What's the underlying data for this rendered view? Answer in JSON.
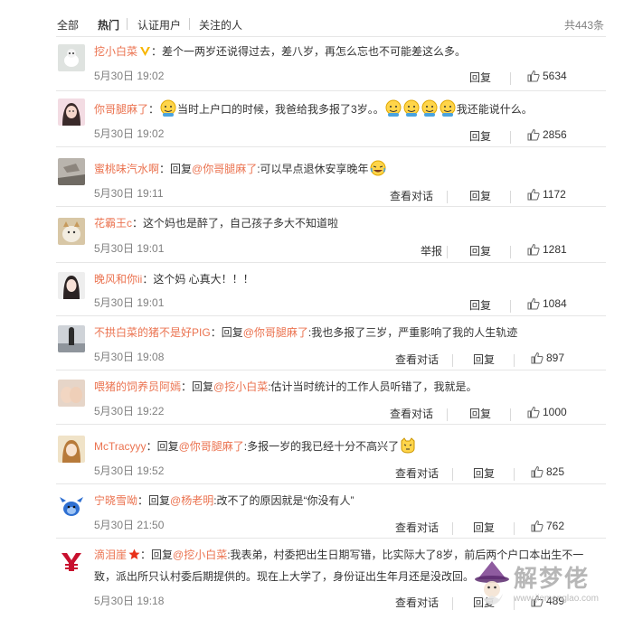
{
  "tabs": {
    "all": "全部",
    "hot": "热门",
    "verified": "认证用户",
    "following": "关注的人",
    "total": "共443条"
  },
  "comments": [
    {
      "user": "挖小白菜",
      "text": "：差个一两岁还说得过去，差八岁，再怎么忘也不可能差这么多。",
      "time": "5月30日 19:02",
      "actions": [
        "回复"
      ],
      "likes": "5634"
    },
    {
      "user": "你哥腿麻了",
      "text_a": "：",
      "text_b": "当时上户口的时候，我爸给我多报了3岁。。",
      "text_c": "我还能说什么。",
      "time": "5月30日 19:02",
      "actions": [
        "回复"
      ],
      "likes": "2856"
    },
    {
      "user": "蜜桃味汽水啊",
      "reply_prefix": "：回复",
      "mention": "@你哥腿麻了",
      "text": ":可以早点退休安享晚年",
      "time": "5月30日 19:11",
      "actions": [
        "查看对话",
        "回复"
      ],
      "likes": "1172"
    },
    {
      "user": "花霸王c",
      "text": "：这个妈也是醉了，自己孩子多大不知道啦",
      "time": "5月30日 19:01",
      "actions": [
        "举报",
        "回复"
      ],
      "likes": "1281"
    },
    {
      "user": "晚风和你ii",
      "text": "：这个妈 心真大！！！",
      "time": "5月30日 19:01",
      "actions": [
        "回复"
      ],
      "likes": "1084"
    },
    {
      "user": "不拱白菜的猪不是好PIG",
      "reply_prefix": "：回复",
      "mention": "@你哥腿麻了",
      "text": ":我也多报了三岁，严重影响了我的人生轨迹",
      "time": "5月30日 19:08",
      "actions": [
        "查看对话",
        "回复"
      ],
      "likes": "897"
    },
    {
      "user": "喂猪的饲养员阿嫣",
      "reply_prefix": "：回复",
      "mention": "@挖小白菜",
      "text": ":估计当时统计的工作人员听错了，我就是。",
      "time": "5月30日 19:22",
      "actions": [
        "查看对话",
        "回复"
      ],
      "likes": "1000"
    },
    {
      "user": "McTracyyy",
      "reply_prefix": "：回复",
      "mention": "@你哥腿麻了",
      "text": ":多报一岁的我已经十分不高兴了",
      "time": "5月30日 19:52",
      "actions": [
        "查看对话",
        "回复"
      ],
      "likes": "825"
    },
    {
      "user": "宁晓雪呦",
      "reply_prefix": "：回复",
      "mention": "@杨老明",
      "text": ":改不了的原因就是“你没有人”",
      "time": "5月30日 21:50",
      "actions": [
        "查看对话",
        "回复"
      ],
      "likes": "762"
    },
    {
      "user": "滴泪崖",
      "reply_prefix": "：回复",
      "mention": "@挖小白菜",
      "text_line1": ":我表弟，村委把出生日期写错，比实际大了8岁，前后两个户口本出生不一",
      "text_line2": "致，派出所只认村委后期提供的。现在上大学了，身份证出生年月还是没改回。",
      "time": "5月30日 19:18",
      "actions": [
        "查看对话",
        "回复"
      ],
      "likes": "489"
    }
  ],
  "watermark": {
    "text": "解梦佬",
    "url": "www.jiemenglao.com"
  },
  "colors": {
    "accent": "#eb7350",
    "muted": "#808080",
    "divider": "#e6e6e6"
  }
}
